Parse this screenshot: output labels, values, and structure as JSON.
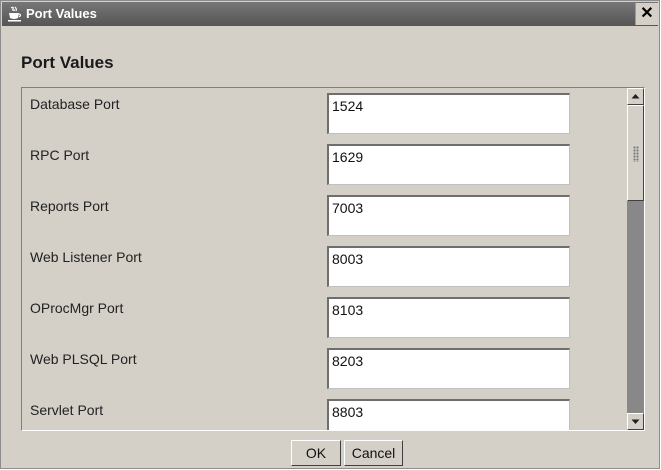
{
  "window": {
    "title": "Port Values",
    "close_glyph": "✕"
  },
  "heading": "Port Values",
  "ports": [
    {
      "label": "Database Port",
      "value": "1524"
    },
    {
      "label": "RPC Port",
      "value": "1629"
    },
    {
      "label": "Reports Port",
      "value": "7003"
    },
    {
      "label": "Web Listener Port",
      "value": "8003"
    },
    {
      "label": "OProcMgr Port",
      "value": "8103"
    },
    {
      "label": "Web PLSQL Port",
      "value": "8203"
    },
    {
      "label": "Servlet Port",
      "value": "8803"
    }
  ],
  "buttons": {
    "ok": "OK",
    "cancel": "Cancel"
  },
  "icons": {
    "window": "java-cup-icon",
    "scroll_up": "arrow-up-icon",
    "scroll_down": "arrow-down-icon"
  }
}
